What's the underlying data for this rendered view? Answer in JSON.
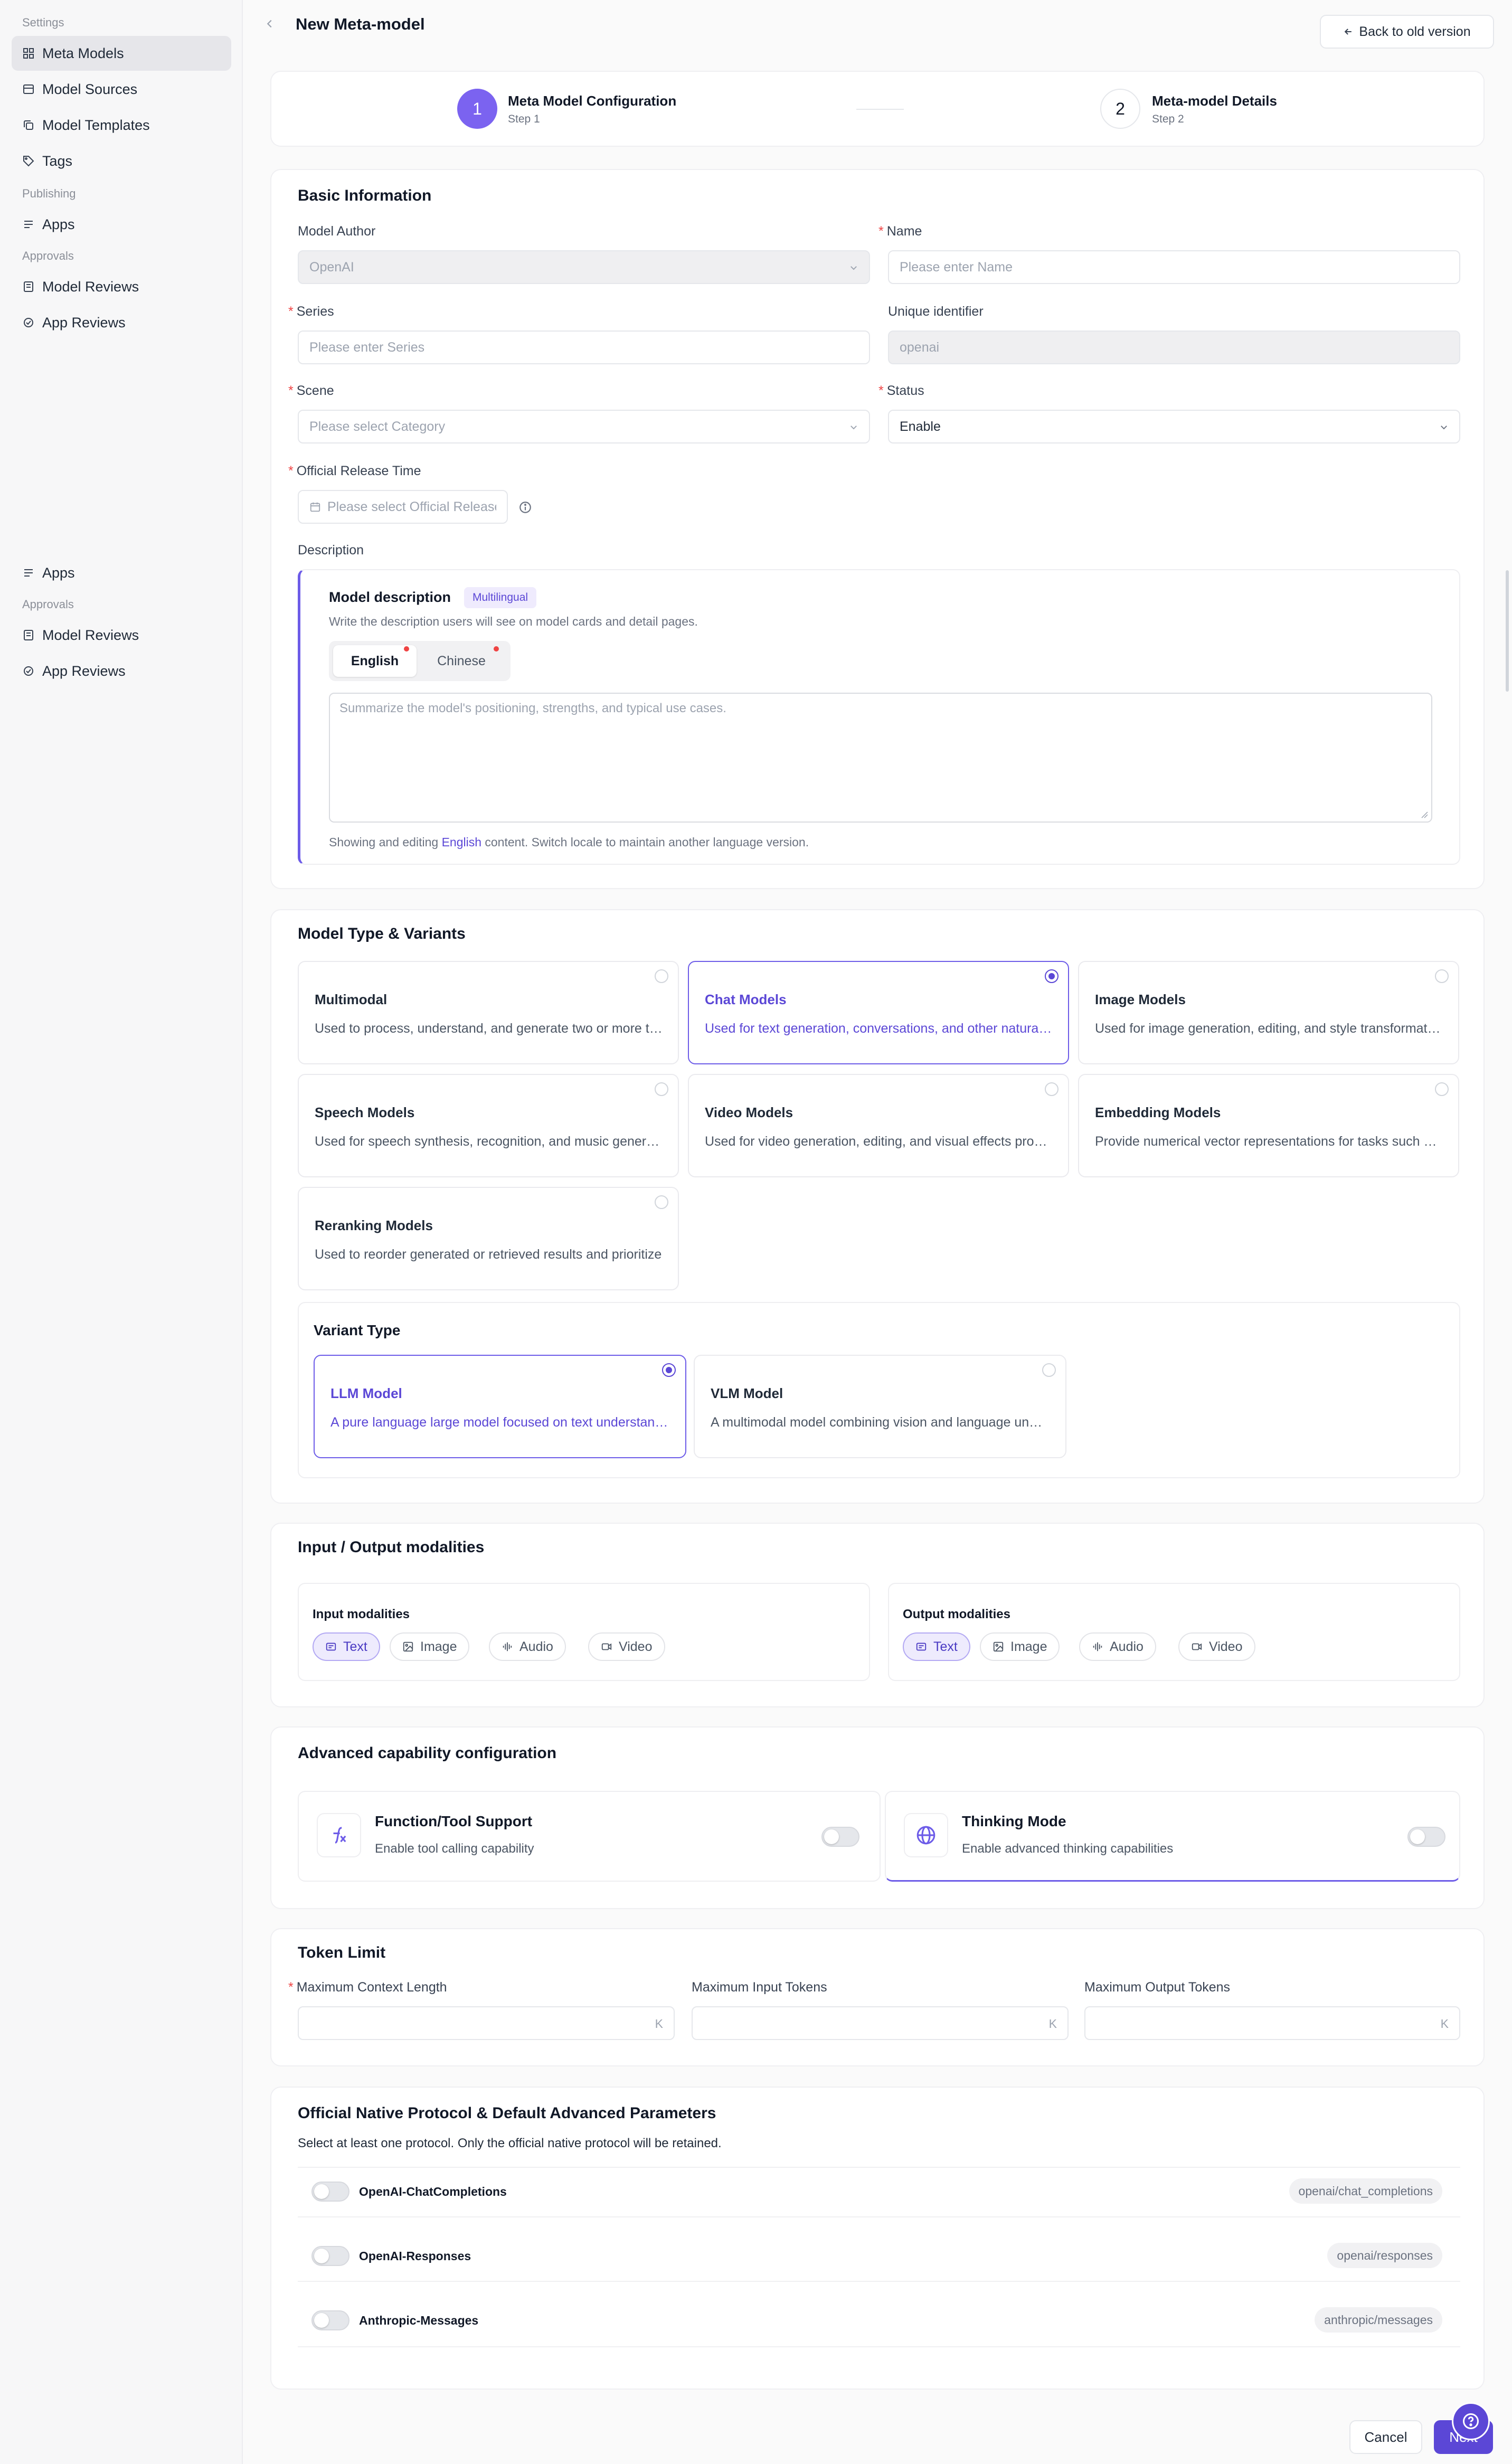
{
  "sidebar": {
    "sections": [
      "Settings",
      "Publishing",
      "Approvals",
      "Approvals"
    ],
    "items": [
      {
        "label": "Meta Models",
        "icon": "grid-icon"
      },
      {
        "label": "Model Sources",
        "icon": "database-icon"
      },
      {
        "label": "Model Templates",
        "icon": "copy-icon"
      },
      {
        "label": "Tags",
        "icon": "tag-icon"
      },
      {
        "label": "Apps",
        "icon": "list-icon"
      },
      {
        "label": "Model Reviews",
        "icon": "review-icon"
      },
      {
        "label": "App Reviews",
        "icon": "review-icon"
      },
      {
        "label": "Apps",
        "icon": "list-icon"
      },
      {
        "label": "Model Reviews",
        "icon": "review-icon"
      },
      {
        "label": "App Reviews",
        "icon": "review-icon"
      }
    ]
  },
  "header": {
    "title": "New Meta-model",
    "back_old": "Back to old version"
  },
  "steps": [
    {
      "num": "1",
      "title": "Meta Model Configuration",
      "sub": "Step 1"
    },
    {
      "num": "2",
      "title": "Meta-model Details",
      "sub": "Step 2"
    }
  ],
  "basic": {
    "title": "Basic Information",
    "author_label": "Model Author",
    "author_value": "OpenAI",
    "name_label": "Name",
    "name_placeholder": "Please enter Name",
    "series_label": "Series",
    "series_placeholder": "Please enter Series",
    "uid_label": "Unique identifier",
    "uid_value": "openai",
    "scene_label": "Scene",
    "scene_placeholder": "Please select Category",
    "status_label": "Status",
    "status_value": "Enable",
    "release_label": "Official Release Time",
    "release_placeholder": "Please select Official Release",
    "desc_label": "Description",
    "desc_title": "Model description",
    "desc_badge": "Multilingual",
    "desc_hint": "Write the description users will see on model cards and detail pages.",
    "tabs": [
      "English",
      "Chinese"
    ],
    "desc_placeholder": "Summarize the model's positioning, strengths, and typical use cases.",
    "footer_pre": "Showing and editing",
    "footer_lang": "English",
    "footer_post": "content. Switch locale to maintain another language version."
  },
  "types": {
    "title": "Model Type & Variants",
    "options": [
      {
        "title": "Multimodal",
        "desc": "Used to process, understand, and generate two or more types of data"
      },
      {
        "title": "Chat Models",
        "desc": "Used for text generation, conversations, and other natural language tasks"
      },
      {
        "title": "Image Models",
        "desc": "Used for image generation, editing, and style transformation"
      },
      {
        "title": "Speech Models",
        "desc": "Used for speech synthesis, recognition, and music generation"
      },
      {
        "title": "Video Models",
        "desc": "Used for video generation, editing, and visual effects processing"
      },
      {
        "title": "Embedding Models",
        "desc": "Provide numerical vector representations for tasks such as search"
      },
      {
        "title": "Reranking Models",
        "desc": "Used to reorder generated or retrieved results and prioritize"
      }
    ],
    "selected": "Chat Models",
    "variant_title": "Variant Type",
    "variants": [
      {
        "title": "LLM Model",
        "desc": "A pure language large model focused on text understanding and generation"
      },
      {
        "title": "VLM Model",
        "desc": "A multimodal model combining vision and language understanding"
      }
    ],
    "variant_selected": "LLM Model"
  },
  "io": {
    "title": "Input / Output modalities",
    "input_label": "Input modalities",
    "output_label": "Output modalities",
    "chips": [
      "Text",
      "Image",
      "Audio",
      "Video"
    ],
    "input_selected": "Text",
    "output_selected": "Text"
  },
  "advanced": {
    "title": "Advanced capability configuration",
    "fn_title": "Function/Tool Support",
    "fn_desc": "Enable tool calling capability",
    "think_title": "Thinking Mode",
    "think_desc": "Enable advanced thinking capabilities"
  },
  "tokens": {
    "title": "Token Limit",
    "ctx_label": "Maximum Context Length",
    "in_label": "Maximum Input Tokens",
    "out_label": "Maximum Output Tokens",
    "unit": "K"
  },
  "protocol": {
    "title": "Official Native Protocol & Default Advanced Parameters",
    "hint": "Select at least one protocol. Only the official native protocol will be retained.",
    "rows": [
      {
        "name": "OpenAI-ChatCompletions",
        "id": "openai/chat_completions"
      },
      {
        "name": "OpenAI-Responses",
        "id": "openai/responses"
      },
      {
        "name": "Anthropic-Messages",
        "id": "anthropic/messages"
      }
    ]
  },
  "footer": {
    "cancel": "Cancel",
    "next": "Next"
  },
  "colors": {
    "accent": "#6d5ce8",
    "accent_text": "#5b47d6",
    "required": "#ef4444"
  }
}
